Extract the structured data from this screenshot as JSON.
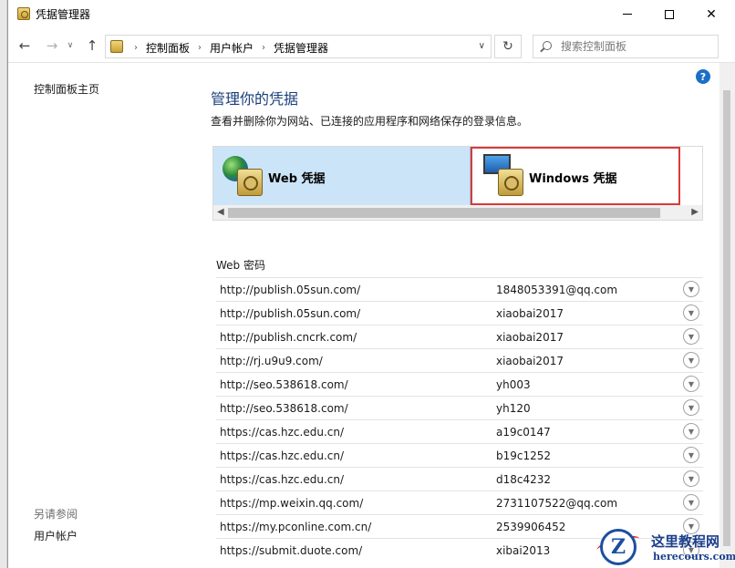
{
  "window": {
    "title": "凭据管理器",
    "controls": {
      "minimize": "minimize",
      "maximize": "maximize",
      "close": "✕"
    }
  },
  "nav": {
    "breadcrumbs": [
      "控制面板",
      "用户帐户",
      "凭据管理器"
    ],
    "search_placeholder": "搜索控制面板"
  },
  "sidebar": {
    "home_link": "控制面板主页",
    "see_also_label": "另请参阅",
    "see_also_items": [
      "用户帐户"
    ]
  },
  "help": {
    "label": "?"
  },
  "main": {
    "title": "管理你的凭据",
    "description": "查看并删除你为网站、已连接的应用程序和网络保存的登录信息。",
    "credential_types": [
      {
        "label": "Web 凭据",
        "selected": true
      },
      {
        "label": "Windows 凭据",
        "selected": false,
        "highlight_color": "#d83a3a"
      }
    ],
    "section_title": "Web 密码",
    "entries": [
      {
        "url": "http://publish.05sun.com/",
        "user": "1848053391@qq.com"
      },
      {
        "url": "http://publish.05sun.com/",
        "user": "xiaobai2017"
      },
      {
        "url": "http://publish.cncrk.com/",
        "user": "xiaobai2017"
      },
      {
        "url": "http://rj.u9u9.com/",
        "user": "xiaobai2017"
      },
      {
        "url": "http://seo.538618.com/",
        "user": "yh003"
      },
      {
        "url": "http://seo.538618.com/",
        "user": "yh120"
      },
      {
        "url": "https://cas.hzc.edu.cn/",
        "user": "a19c0147"
      },
      {
        "url": "https://cas.hzc.edu.cn/",
        "user": "b19c1252"
      },
      {
        "url": "https://cas.hzc.edu.cn/",
        "user": "d18c4232"
      },
      {
        "url": "https://mp.weixin.qq.com/",
        "user": "2731107522@qq.com"
      },
      {
        "url": "https://my.pconline.com.cn/",
        "user": "2539906452"
      },
      {
        "url": "https://submit.duote.com/",
        "user": "xibai2013"
      }
    ]
  },
  "watermark": {
    "title": "这里教程网",
    "domain": "herecours.com",
    "logo_letter": "Z"
  },
  "colors": {
    "accent": "#1c6fc7",
    "title_blue": "#1a3f7a",
    "selected_bg": "#cce4f7",
    "highlight_red": "#d83a3a"
  }
}
